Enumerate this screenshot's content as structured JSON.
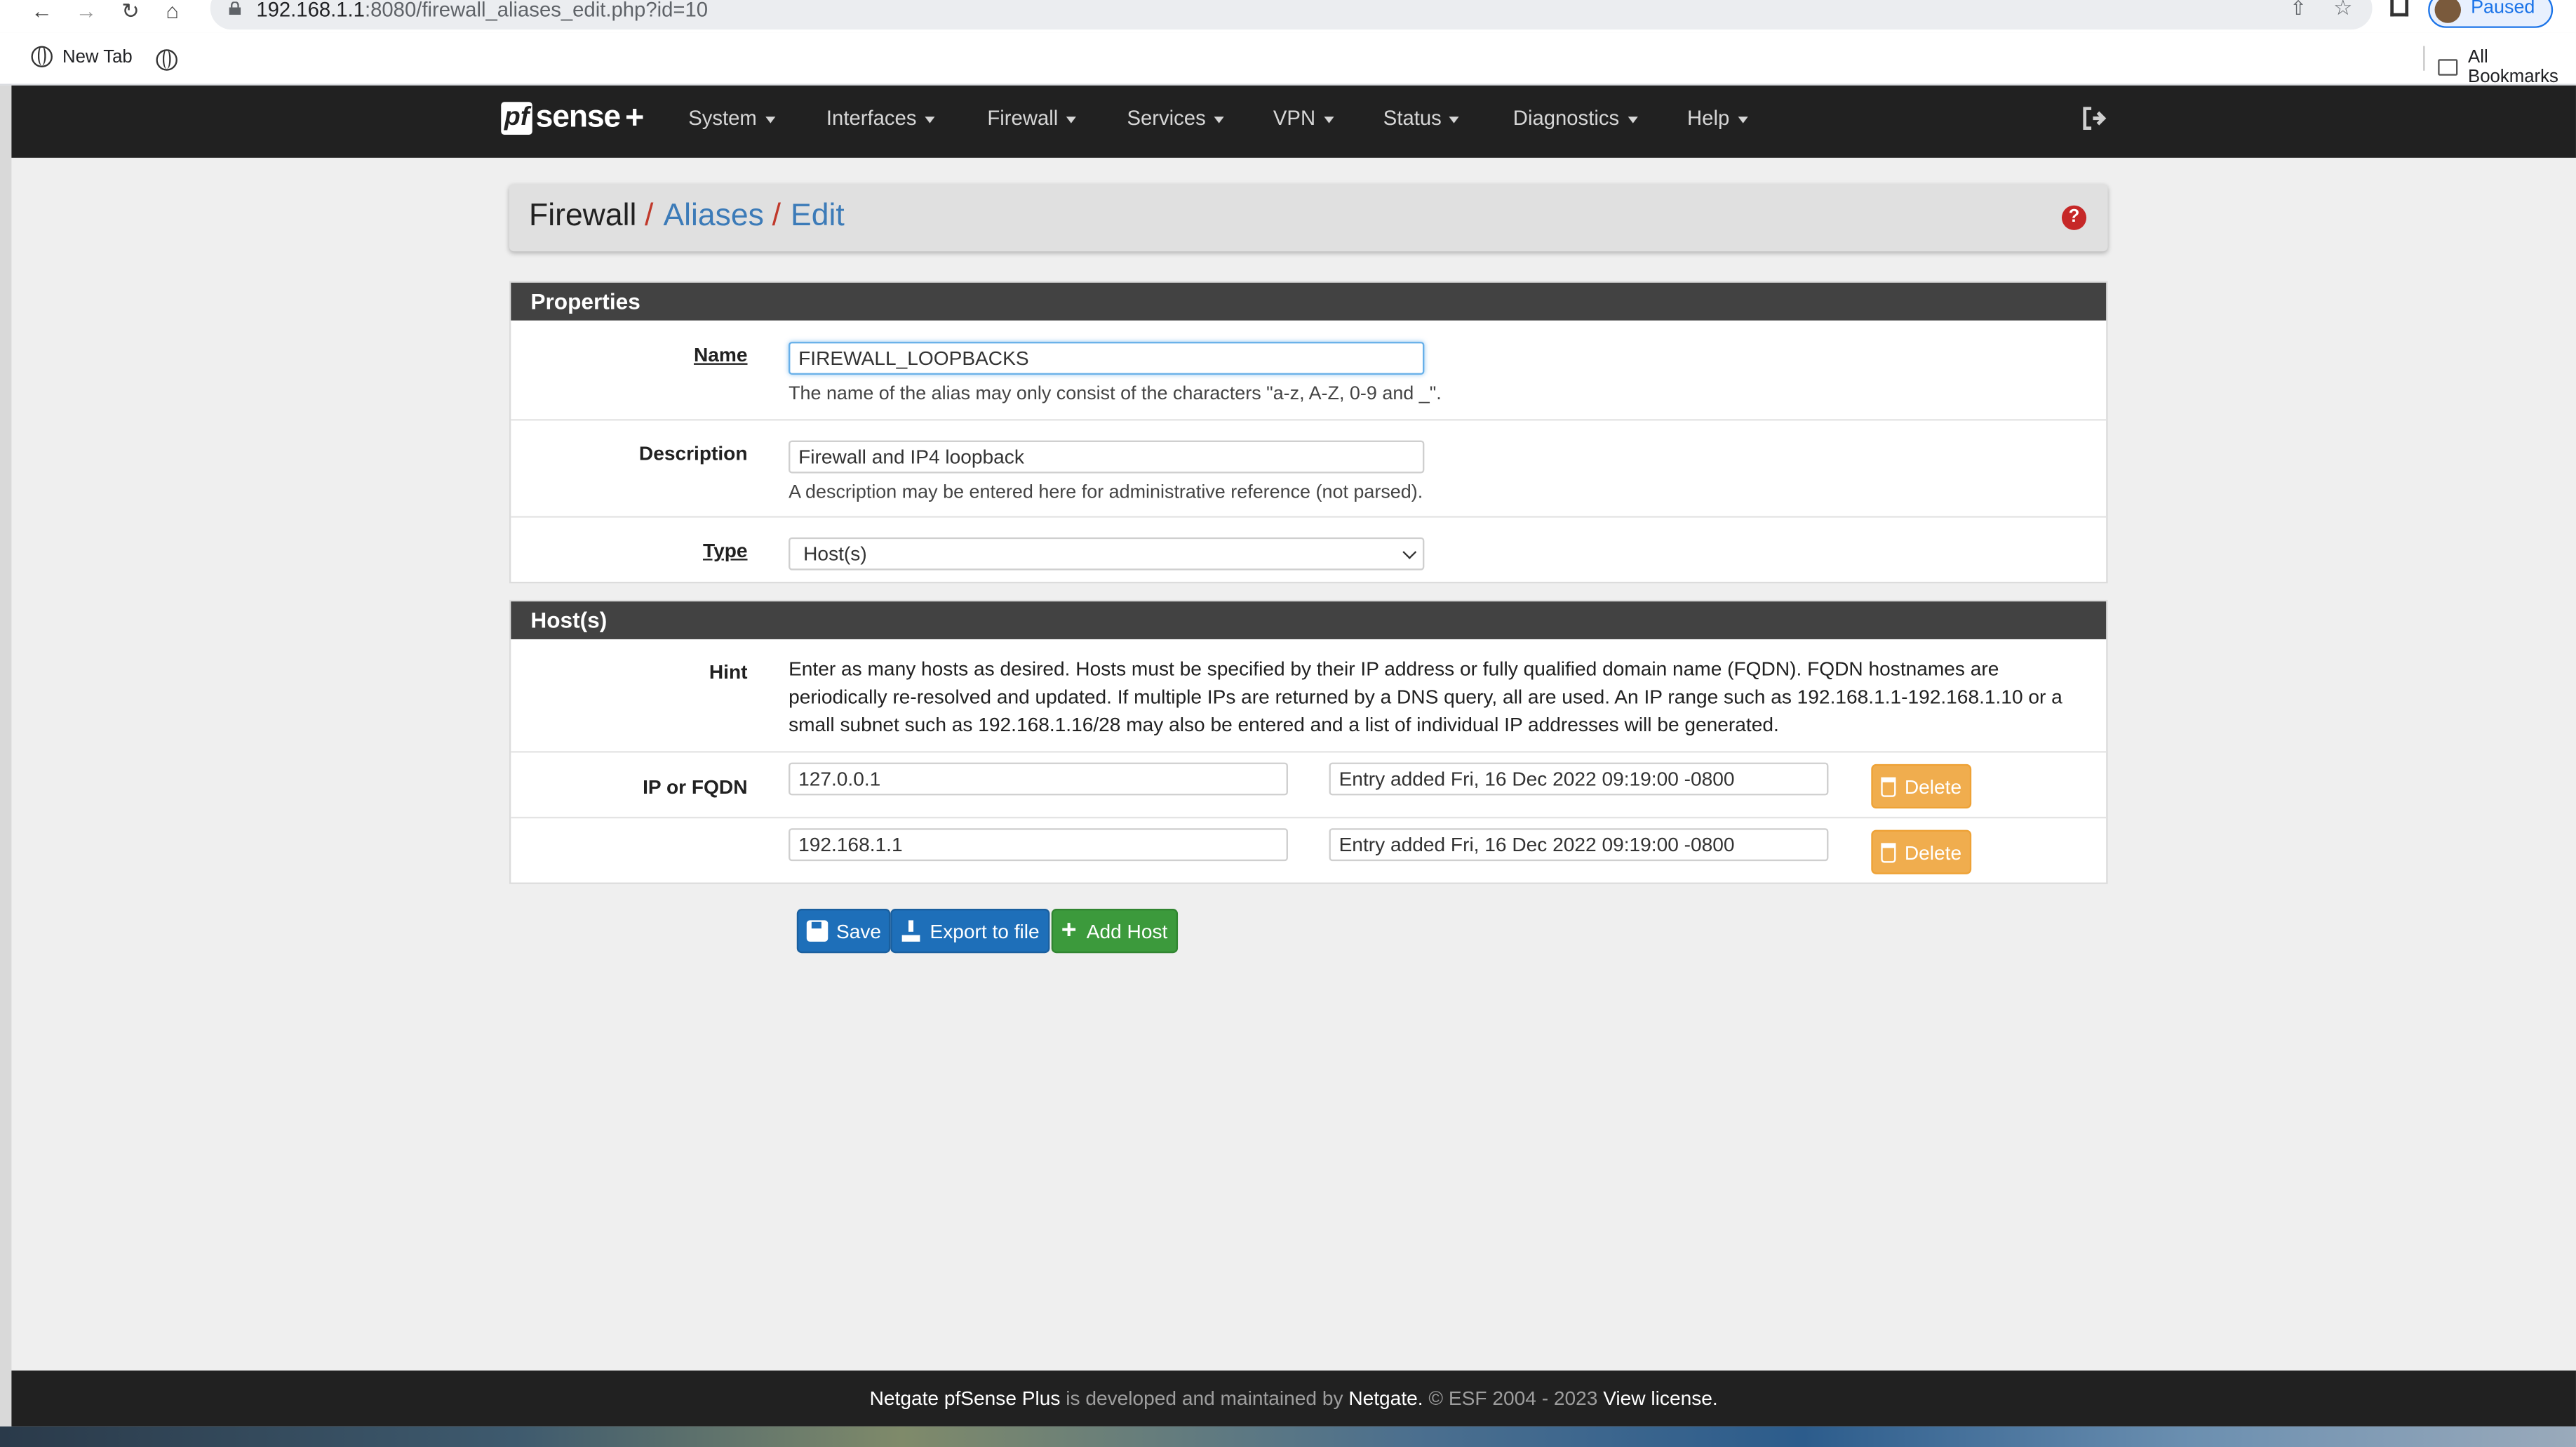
{
  "browser": {
    "url_host": "192.168.1.1",
    "url_path": ":8080/firewall_aliases_edit.php?id=10",
    "profile_status": "Paused",
    "bookmarks": [
      "New Tab"
    ],
    "all_bookmarks": "All Bookmarks"
  },
  "nav": {
    "logo_pf": "pf",
    "logo_sense": "sense",
    "logo_plus": "+",
    "menu": [
      "System",
      "Interfaces",
      "Firewall",
      "Services",
      "VPN",
      "Status",
      "Diagnostics",
      "Help"
    ]
  },
  "breadcrumb": {
    "root": "Firewall",
    "level1": "Aliases",
    "level2": "Edit",
    "sep": "/"
  },
  "properties": {
    "heading": "Properties",
    "name_label": "Name",
    "name_value": "FIREWALL_LOOPBACKS",
    "name_hint": "The name of the alias may only consist of the characters \"a-z, A-Z, 0-9 and _\".",
    "description_label": "Description",
    "description_value": "Firewall and IP4 loopback",
    "description_hint": "A description may be entered here for administrative reference (not parsed).",
    "type_label": "Type",
    "type_value": "Host(s)"
  },
  "hosts": {
    "heading": "Host(s)",
    "hint_label": "Hint",
    "hint_text": "Enter as many hosts as desired. Hosts must be specified by their IP address or fully qualified domain name (FQDN). FQDN hostnames are periodically re-resolved and updated. If multiple IPs are returned by a DNS query, all are used. An IP range such as 192.168.1.1-192.168.1.10 or a small subnet such as 192.168.1.16/28 may also be entered and a list of individual IP addresses will be generated.",
    "ip_label": "IP or FQDN",
    "rows": [
      {
        "ip": "127.0.0.1",
        "desc": "Entry added Fri, 16 Dec 2022 09:19:00 -0800",
        "delete": "Delete"
      },
      {
        "ip": "192.168.1.1",
        "desc": "Entry added Fri, 16 Dec 2022 09:19:00 -0800",
        "delete": "Delete"
      }
    ]
  },
  "actions": {
    "save": "Save",
    "export": "Export to file",
    "add_host": "Add Host"
  },
  "footer": {
    "brand": "Netgate pfSense Plus",
    "mid": " is developed and maintained by ",
    "company": "Netgate.",
    "copy": " © ESF 2004 - 2023 ",
    "license": "View license."
  },
  "colors": {
    "topbar": "#212121",
    "link": "#3c7bb8",
    "delete": "#f0ad4e",
    "primary": "#1e6fb9",
    "success": "#3c9a3c",
    "help": "#c62828"
  }
}
